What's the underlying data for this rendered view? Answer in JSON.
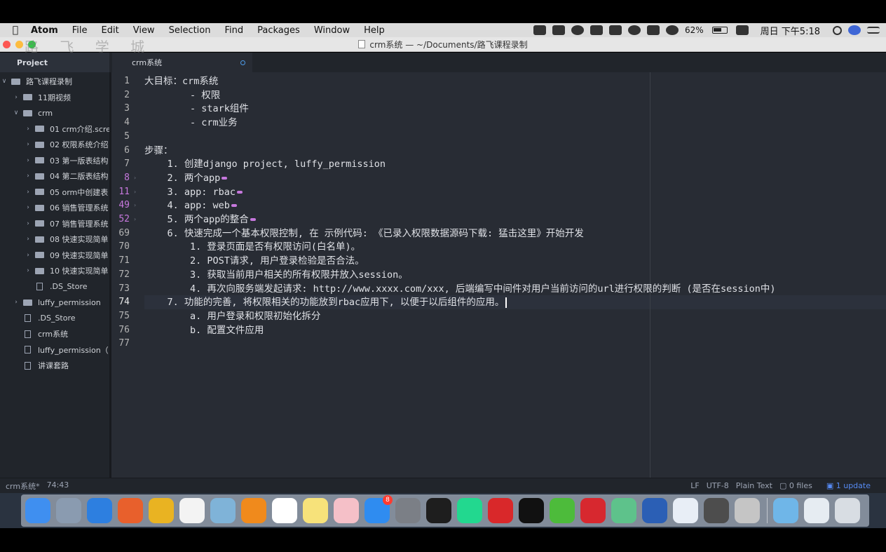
{
  "menubar": {
    "app_name": "Atom",
    "items": [
      "File",
      "Edit",
      "View",
      "Selection",
      "Find",
      "Packages",
      "Window",
      "Help"
    ],
    "battery": "62%",
    "clock": "周日 下午5:18"
  },
  "window": {
    "title": "crm系统 — ~/Documents/路飞课程录制",
    "watermark": "路 飞 学 城"
  },
  "tabs": {
    "project_label": "Project",
    "file_label": "crm系统"
  },
  "tree": [
    {
      "label": "路飞课程录制",
      "kind": "folder",
      "expanded": true,
      "indent": 0
    },
    {
      "label": "11期视频",
      "kind": "folder",
      "expanded": false,
      "indent": 1
    },
    {
      "label": "crm",
      "kind": "folder",
      "expanded": true,
      "indent": 1
    },
    {
      "label": "01 crm介绍.scre",
      "kind": "folder",
      "expanded": false,
      "indent": 2
    },
    {
      "label": "02 权限系统介绍",
      "kind": "folder",
      "expanded": false,
      "indent": 2
    },
    {
      "label": "03 第一版表结构",
      "kind": "folder",
      "expanded": false,
      "indent": 2
    },
    {
      "label": "04 第二版表结构",
      "kind": "folder",
      "expanded": false,
      "indent": 2
    },
    {
      "label": "05 orm中创建表",
      "kind": "folder",
      "expanded": false,
      "indent": 2
    },
    {
      "label": "06 销售管理系统",
      "kind": "folder",
      "expanded": false,
      "indent": 2
    },
    {
      "label": "07 销售管理系统",
      "kind": "folder",
      "expanded": false,
      "indent": 2
    },
    {
      "label": "08 快速实现简单",
      "kind": "folder",
      "expanded": false,
      "indent": 2
    },
    {
      "label": "09 快速实现简单",
      "kind": "folder",
      "expanded": false,
      "indent": 2
    },
    {
      "label": "10 快速实现简单",
      "kind": "folder",
      "expanded": false,
      "indent": 2
    },
    {
      "label": ".DS_Store",
      "kind": "file",
      "indent": 2
    },
    {
      "label": "luffy_permission",
      "kind": "folder",
      "expanded": false,
      "indent": 1
    },
    {
      "label": ".DS_Store",
      "kind": "file",
      "indent": 1
    },
    {
      "label": "crm系统",
      "kind": "file",
      "indent": 1
    },
    {
      "label": "luffy_permission（",
      "kind": "file",
      "indent": 1
    },
    {
      "label": "讲课套路",
      "kind": "file",
      "indent": 1
    }
  ],
  "editor": {
    "active_line_index": 16,
    "lines": [
      {
        "num": "1",
        "text": "大目标：crm系统",
        "fold": false
      },
      {
        "num": "2",
        "text": "        - 权限",
        "fold": false
      },
      {
        "num": "3",
        "text": "        - stark组件",
        "fold": false
      },
      {
        "num": "4",
        "text": "        - crm业务",
        "fold": false
      },
      {
        "num": "5",
        "text": "",
        "fold": false
      },
      {
        "num": "6",
        "text": "步骤：",
        "fold": false
      },
      {
        "num": "7",
        "text": "    1. 创建django project, luffy_permission",
        "fold": false
      },
      {
        "num": "8",
        "text": "    2. 两个app",
        "fold": true
      },
      {
        "num": "11",
        "text": "    3. app: rbac",
        "fold": true
      },
      {
        "num": "49",
        "text": "    4. app: web",
        "fold": true
      },
      {
        "num": "52",
        "text": "    5. 两个app的整合",
        "fold": true
      },
      {
        "num": "69",
        "text": "    6. 快速完成一个基本权限控制, 在 示例代码: 《已录入权限数据源码下载: 猛击这里》开始开发",
        "fold": false
      },
      {
        "num": "70",
        "text": "        1. 登录页面是否有权限访问(白名单)。",
        "fold": false
      },
      {
        "num": "71",
        "text": "        2. POST请求, 用户登录检验是否合法。",
        "fold": false
      },
      {
        "num": "72",
        "text": "        3. 获取当前用户相关的所有权限并放入session。",
        "fold": false
      },
      {
        "num": "73",
        "text": "        4. 再次向服务端发起请求: http://www.xxxx.com/xxx, 后端编写中间件对用户当前访问的url进行权限的判断 (是否在session中)",
        "fold": false
      },
      {
        "num": "74",
        "text": "    7. 功能的完善, 将权限相关的功能放到rbac应用下, 以便于以后组件的应用。",
        "fold": false
      },
      {
        "num": "75",
        "text": "        a. 用户登录和权限初始化拆分",
        "fold": false
      },
      {
        "num": "76",
        "text": "        b. 配置文件应用",
        "fold": false
      },
      {
        "num": "77",
        "text": "",
        "fold": false
      }
    ]
  },
  "statusbar": {
    "file": "crm系统*",
    "position": "74:43",
    "line_ending": "LF",
    "encoding": "UTF-8",
    "grammar": "Plain Text",
    "git_files": "0 files",
    "updates": "1 update"
  },
  "dock": {
    "icons": [
      {
        "name": "finder-icon",
        "color": "#3f8ff0"
      },
      {
        "name": "launchpad-icon",
        "color": "#8a9bb0"
      },
      {
        "name": "safari-icon",
        "color": "#2d7fe0"
      },
      {
        "name": "firefox-icon",
        "color": "#e8602c"
      },
      {
        "name": "chrome-icon",
        "color": "#e9b322"
      },
      {
        "name": "launchpad-grid-icon",
        "color": "#f3f3f3"
      },
      {
        "name": "preview-icon",
        "color": "#7fb3d8"
      },
      {
        "name": "ibooks-icon",
        "color": "#f08a1c"
      },
      {
        "name": "calendar-icon",
        "color": "#ffffff"
      },
      {
        "name": "notes-icon",
        "color": "#f7e27a"
      },
      {
        "name": "photos-icon",
        "color": "#f5c0c8"
      },
      {
        "name": "appstore-icon",
        "color": "#2f8cf0",
        "badge": "8"
      },
      {
        "name": "system-preferences-icon",
        "color": "#7b7f86"
      },
      {
        "name": "terminal-icon",
        "color": "#1e1e1e"
      },
      {
        "name": "pycharm-icon",
        "color": "#22d88f"
      },
      {
        "name": "netease-music-icon",
        "color": "#d9282a"
      },
      {
        "name": "qq-icon",
        "color": "#111111"
      },
      {
        "name": "wechat-icon",
        "color": "#4dbb3b"
      },
      {
        "name": "g-app-icon",
        "color": "#d7282f"
      },
      {
        "name": "atom-icon",
        "color": "#5ec28b"
      },
      {
        "name": "word-icon",
        "color": "#2b5fb5"
      },
      {
        "name": "bird-app-icon",
        "color": "#e8eef6"
      },
      {
        "name": "sublime-icon",
        "color": "#4d4d4d"
      },
      {
        "name": "movie-icon",
        "color": "#c5c5c5"
      },
      {
        "name": "downloads-folder-icon",
        "color": "#6fb6e8"
      },
      {
        "name": "documents-stack-icon",
        "color": "#e6ecf2"
      },
      {
        "name": "trash-icon",
        "color": "#d8dde3"
      }
    ]
  }
}
